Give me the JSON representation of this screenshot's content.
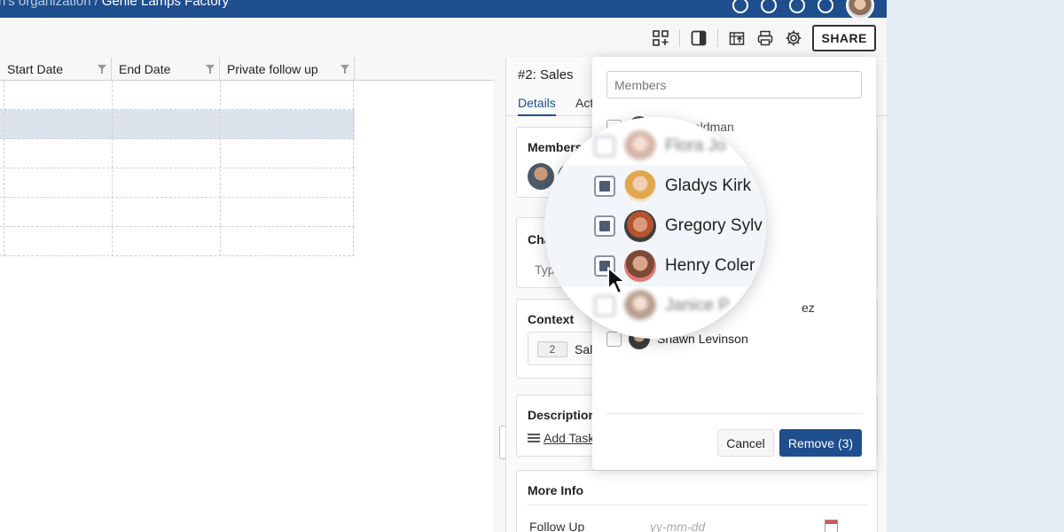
{
  "header": {
    "breadcrumb_org": "n's organization",
    "breadcrumb_sep": "/",
    "breadcrumb_project": "Genie Lamps Factory"
  },
  "toolbar": {
    "share_label": "SHARE"
  },
  "grid": {
    "columns": [
      "Start Date",
      "End Date",
      "Private follow up"
    ],
    "row_count": 6,
    "selected_row_index": 1
  },
  "detail": {
    "title": "#2:  Sales",
    "tabs": [
      "Details",
      "Act"
    ],
    "members_title": "Members",
    "chat_partial": "Cha",
    "type_partial": "Typ",
    "context_title": "Context",
    "context_badge": "2",
    "context_text": "Sal",
    "description_title": "Description",
    "add_task": "Add Task",
    "more_info_title": "More Info",
    "follow_up_label": "Follow Up",
    "follow_up_placeholder": "yy-mm-dd"
  },
  "popup": {
    "search_placeholder": "Members",
    "members": [
      {
        "name": "Goldman",
        "checked": false,
        "blurred": true
      },
      {
        "name": "Flora Jo",
        "checked": false,
        "blurred": true
      },
      {
        "name": "Gladys Kirk",
        "checked": true,
        "blurred": false
      },
      {
        "name": "Gregory Sylv",
        "checked": true,
        "blurred": false
      },
      {
        "name": "Henry Coler",
        "checked": true,
        "blurred": false
      },
      {
        "name": "Janice P",
        "checked": false,
        "blurred": true
      },
      {
        "name": "ez",
        "checked": false,
        "blurred": false
      },
      {
        "name": "Shawn Levinson",
        "checked": false,
        "blurred": false
      }
    ],
    "cancel_label": "Cancel",
    "remove_label": "Remove (3)"
  },
  "colors": {
    "brand": "#1f4e8c",
    "selected_row": "#dce3ed"
  }
}
